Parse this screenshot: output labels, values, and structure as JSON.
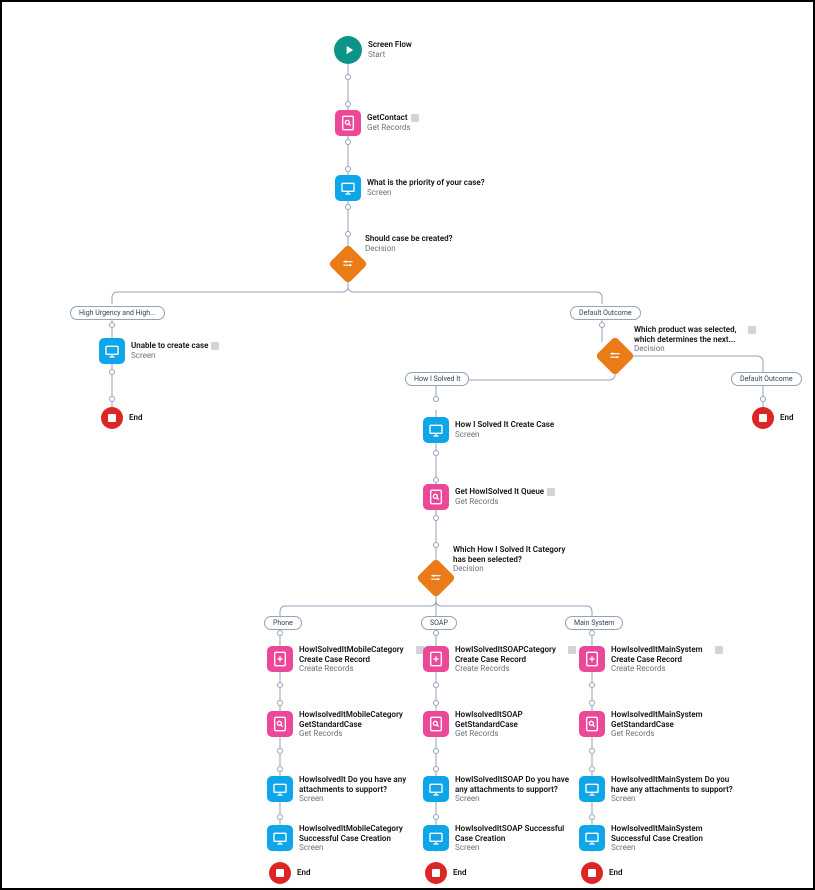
{
  "nodes": {
    "start": {
      "title": "Screen Flow",
      "sub": "Start"
    },
    "getContact": {
      "title": "GetContact",
      "sub": "Get Records"
    },
    "priority": {
      "title": "What is the priority of your case?",
      "sub": "Screen"
    },
    "shouldCreate": {
      "title": "Should case be created?",
      "sub": "Decision"
    },
    "unableCreate": {
      "title": "Unable to create case",
      "sub": "Screen"
    },
    "whichProduct": {
      "title": "Which product was selected,",
      "title2": "which determines the next...",
      "sub": "Decision"
    },
    "hisCreateCase": {
      "title": "How I Solved It Create Case",
      "sub": "Screen"
    },
    "getHisQueue": {
      "title": "Get HowISolved It Queue",
      "sub": "Get Records"
    },
    "whichCategory": {
      "title": "Which How I Solved It Category",
      "title2": "has been selected?",
      "sub": "Decision"
    },
    "phoneCreate": {
      "title": "HowISolvedItMobileCategory",
      "title2": "Create Case Record",
      "sub": "Create Records"
    },
    "phoneGet": {
      "title": "HowIsolvedItMobileCategory",
      "title2": "GetStandardCase",
      "sub": "Get Records"
    },
    "phoneAttach": {
      "title": "HowIsolvedIt Do you have any",
      "title2": "attachments to support?",
      "sub": "Screen"
    },
    "phoneSuccess": {
      "title": "HowIsolvedItMobileCategory",
      "title2": "Successful Case Creation",
      "sub": "Screen"
    },
    "soapCreate": {
      "title": "HowISolvedItSOAPCategory",
      "title2": "Create Case Record",
      "sub": "Create Records"
    },
    "soapGet": {
      "title": "HowIsolvedItSOAP",
      "title2": "GetStandardCase",
      "sub": "Get Records"
    },
    "soapAttach": {
      "title": "HowISolvedItSOAP Do you have",
      "title2": "any attachments to support?",
      "sub": "Screen"
    },
    "soapSuccess": {
      "title": "HowIsolvedItSOAP Successful",
      "title2": "Case Creation",
      "sub": "Screen"
    },
    "mainCreate": {
      "title": "HowIsolvedItMainSystem",
      "title2": "Create Case Record",
      "sub": "Create Records"
    },
    "mainGet": {
      "title": "HowIsolvedItMainSystem",
      "title2": "GetStandardCase",
      "sub": "Get Records"
    },
    "mainAttach": {
      "title": "HowIsolvedItMainSystem Do you",
      "title2": "have any attachments to support?",
      "sub": "Screen"
    },
    "mainSuccess": {
      "title": "HowIsolvedItMainSystem",
      "title2": "Successful Case Creation",
      "sub": "Screen"
    },
    "end": "End"
  },
  "pills": {
    "highUrgency": "High Urgency and High...",
    "defaultOutcome": "Default Outcome",
    "howISolvedIt": "How I Solved It",
    "phone": "Phone",
    "soap": "SOAP",
    "mainSystem": "Main System"
  }
}
